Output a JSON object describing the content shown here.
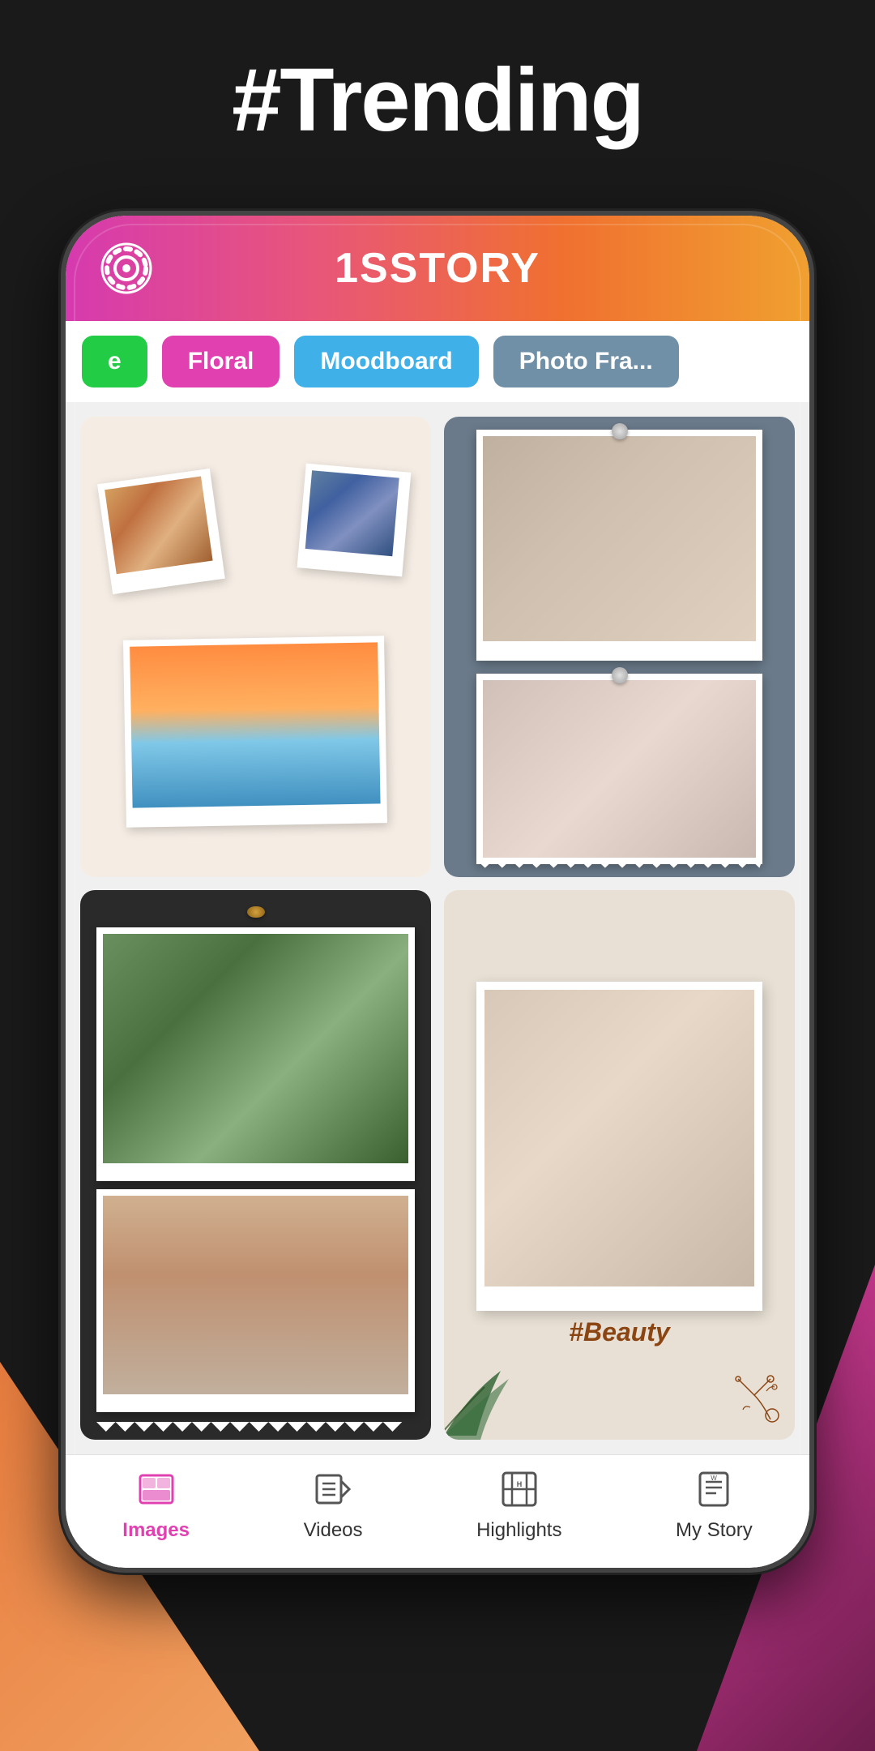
{
  "page": {
    "background_color": "#1a1a1a",
    "trending_title": "#Trending"
  },
  "app": {
    "name": "1SSTORY",
    "header_gradient_start": "#d63aaf",
    "header_gradient_end": "#f0a030"
  },
  "tabs": [
    {
      "label": "e",
      "color": "green",
      "active": false
    },
    {
      "label": "Floral",
      "color": "pink",
      "active": false
    },
    {
      "label": "Moodboard",
      "color": "blue",
      "active": true
    },
    {
      "label": "Photo Fra...",
      "color": "gray",
      "active": false
    }
  ],
  "templates": [
    {
      "id": 1,
      "type": "polaroid-collage",
      "bg": "cream"
    },
    {
      "id": 2,
      "type": "torn-pinned",
      "bg": "gray"
    },
    {
      "id": 3,
      "type": "dark-frame",
      "bg": "dark"
    },
    {
      "id": 4,
      "type": "beauty",
      "bg": "sand",
      "hashtag": "#Beauty"
    }
  ],
  "bottom_nav": [
    {
      "id": "images",
      "label": "Images",
      "active": true
    },
    {
      "id": "videos",
      "label": "Videos",
      "active": false
    },
    {
      "id": "highlights",
      "label": "Highlights",
      "active": false
    },
    {
      "id": "my-story",
      "label": "My Story",
      "active": false
    }
  ]
}
